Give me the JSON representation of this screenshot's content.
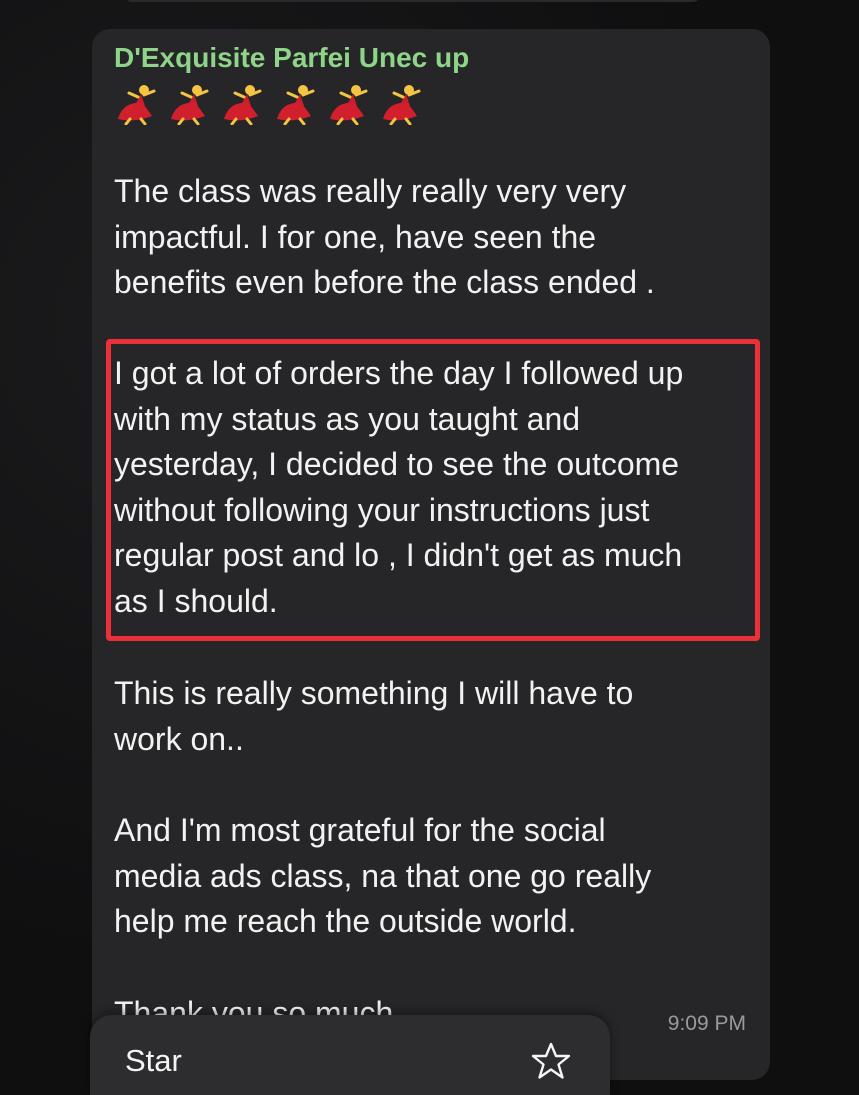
{
  "message": {
    "sender": "D'Exquisite Parfei Unec up",
    "emoji": [
      "dancer-emoji",
      "dancer-emoji",
      "dancer-emoji",
      "dancer-emoji",
      "dancer-emoji",
      "dancer-emoji"
    ],
    "paragraphs": [
      "The class was really really very very\nimpactful. I for one, have seen the\nbenefits even before the class ended .",
      "I got a lot of orders the day I followed up\nwith my status as you taught and\nyesterday, I decided to see the outcome\nwithout following your instructions just\nregular post and lo , I didn't get as much\nas I should.",
      "This is really something I will have to\nwork on..",
      "And I'm most grateful for the social\nmedia ads class, na that one go really\nhelp me reach the outside world.",
      "Thank you so much"
    ],
    "time": "9:09 PM"
  },
  "context_menu": {
    "star_label": "Star",
    "star_icon": "star-outline-icon"
  },
  "colors": {
    "background": "#0f0f10",
    "bubble": "#262628",
    "sender_name": "#8ed589",
    "highlight_border": "#ec3039",
    "menu_background": "#2d2d30"
  }
}
